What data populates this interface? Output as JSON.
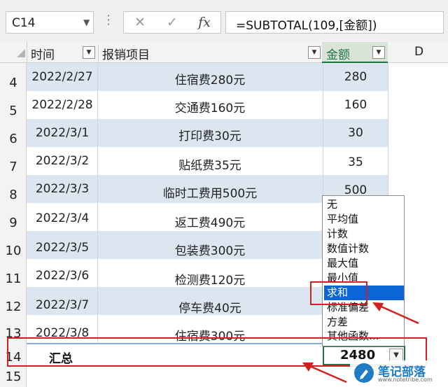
{
  "formula_bar": {
    "name_box": "C14",
    "formula": "=SUBTOTAL(109,[金额])",
    "fx_label": "fx"
  },
  "columns": {
    "time": "时间",
    "item": "报销项目",
    "amount": "金额",
    "d": "D"
  },
  "rows": [
    {
      "num": "4",
      "date": "2022/2/27",
      "item": "住宿费280元",
      "amount": "280"
    },
    {
      "num": "5",
      "date": "2022/2/28",
      "item": "交通费160元",
      "amount": "160"
    },
    {
      "num": "6",
      "date": "2022/3/1",
      "item": "打印费30元",
      "amount": "30"
    },
    {
      "num": "7",
      "date": "2022/3/2",
      "item": "贴纸费35元",
      "amount": "35"
    },
    {
      "num": "8",
      "date": "2022/3/3",
      "item": "临时工费用500元",
      "amount": "500"
    },
    {
      "num": "9",
      "date": "2022/3/4",
      "item": "返工费490元",
      "amount": ""
    },
    {
      "num": "10",
      "date": "2022/3/5",
      "item": "包装费300元",
      "amount": ""
    },
    {
      "num": "11",
      "date": "2022/3/6",
      "item": "检测费120元",
      "amount": ""
    },
    {
      "num": "12",
      "date": "2022/3/7",
      "item": "停车费40元",
      "amount": ""
    },
    {
      "num": "13",
      "date": "2022/3/8",
      "item": "住宿费300元",
      "amount": ""
    }
  ],
  "total_row": {
    "num": "14",
    "label": "汇总",
    "value": "2480"
  },
  "row15": {
    "num": "15"
  },
  "dropdown": {
    "items": [
      "无",
      "平均值",
      "计数",
      "数值计数",
      "最大值",
      "最小值",
      "求和",
      "标准偏差",
      "方差",
      "其他函数..."
    ],
    "selected": "求和"
  },
  "watermark": {
    "title": "笔记部落",
    "url": "www.notetribe.com"
  },
  "colors": {
    "band": "#dce6f1",
    "annotation_red": "#d2201f",
    "selected_blue": "#0a66d6"
  }
}
